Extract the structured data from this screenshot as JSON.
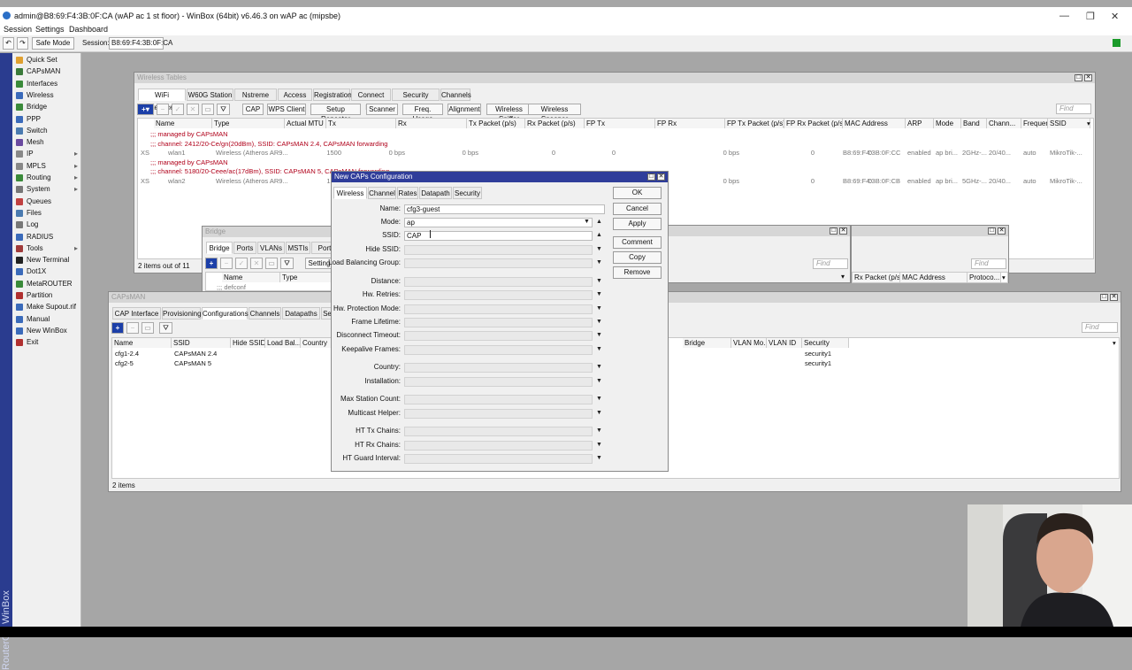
{
  "window": {
    "title": "admin@B8:69:F4:3B:0F:CA (wAP ac 1 st floor) - WinBox (64bit) v6.46.3 on wAP ac (mipsbe)",
    "minimize": "—",
    "maximize": "❐",
    "close": "✕"
  },
  "menu": [
    "Session",
    "Settings",
    "Dashboard"
  ],
  "toolbar": {
    "undo": "↶",
    "redo": "↷",
    "safe_mode": "Safe Mode",
    "session_label": "Session:",
    "session_value": "B8:69:F4:3B:0F:CA",
    "status_icon": "connected-square"
  },
  "brand": "RouterOS WinBox",
  "sidebar": [
    {
      "label": "Quick Set",
      "icon": "quick-set-icon",
      "color": "#e0a030"
    },
    {
      "label": "CAPsMAN",
      "icon": "capsman-icon",
      "color": "#3a7a3a"
    },
    {
      "label": "Interfaces",
      "icon": "interfaces-icon",
      "color": "#3a8a3a"
    },
    {
      "label": "Wireless",
      "icon": "wireless-icon",
      "color": "#3a6aba"
    },
    {
      "label": "Bridge",
      "icon": "bridge-icon",
      "color": "#3a8a3a"
    },
    {
      "label": "PPP",
      "icon": "ppp-icon",
      "color": "#3a6aba"
    },
    {
      "label": "Switch",
      "icon": "switch-icon",
      "color": "#4a7ab0"
    },
    {
      "label": "Mesh",
      "icon": "mesh-icon",
      "color": "#6a4aa0"
    },
    {
      "label": "IP",
      "icon": "ip-icon",
      "color": "#888",
      "arrow": "▸"
    },
    {
      "label": "MPLS",
      "icon": "mpls-icon",
      "color": "#888",
      "arrow": "▸"
    },
    {
      "label": "Routing",
      "icon": "routing-icon",
      "color": "#3a8a3a",
      "arrow": "▸"
    },
    {
      "label": "System",
      "icon": "system-icon",
      "color": "#777",
      "arrow": "▸"
    },
    {
      "label": "Queues",
      "icon": "queues-icon",
      "color": "#c04040"
    },
    {
      "label": "Files",
      "icon": "files-icon",
      "color": "#4a7ab0"
    },
    {
      "label": "Log",
      "icon": "log-icon",
      "color": "#777"
    },
    {
      "label": "RADIUS",
      "icon": "radius-icon",
      "color": "#3a6aba"
    },
    {
      "label": "Tools",
      "icon": "tools-icon",
      "color": "#a03a3a",
      "arrow": "▸"
    },
    {
      "label": "New Terminal",
      "icon": "terminal-icon",
      "color": "#222"
    },
    {
      "label": "Dot1X",
      "icon": "dot1x-icon",
      "color": "#3a6aba"
    },
    {
      "label": "MetaROUTER",
      "icon": "metarouter-icon",
      "color": "#3a8a3a"
    },
    {
      "label": "Partition",
      "icon": "partition-icon",
      "color": "#b03030"
    },
    {
      "label": "Make Supout.rif",
      "icon": "supout-icon",
      "color": "#3a6aba"
    },
    {
      "label": "Manual",
      "icon": "manual-icon",
      "color": "#3a6aba"
    },
    {
      "label": "New WinBox",
      "icon": "winbox-icon",
      "color": "#3a6aba"
    },
    {
      "label": "Exit",
      "icon": "exit-icon",
      "color": "#b03030"
    }
  ],
  "wt": {
    "title": "Wireless Tables",
    "tabs": [
      "WiFi Interfaces",
      "W60G Station",
      "Nstreme Dual",
      "Access List",
      "Registration",
      "Connect List",
      "Security Profiles",
      "Channels"
    ],
    "buttons": [
      "CAP",
      "WPS Client",
      "Setup Repeater",
      "Scanner",
      "Freq. Usage",
      "Alignment",
      "Wireless Sniffer",
      "Wireless Snooper"
    ],
    "find": "Find",
    "columns": [
      "Name",
      "Type",
      "Actual MTU",
      "Tx",
      "Rx",
      "Tx Packet (p/s)",
      "Rx Packet (p/s)",
      "FP Tx",
      "FP Rx",
      "FP Tx Packet (p/s)",
      "FP Rx Packet (p/s)",
      "MAC Address",
      "ARP",
      "Mode",
      "Band",
      "Chann...",
      "Frequen...",
      "SSID"
    ],
    "rows": [
      {
        "comment": ";;; managed by CAPsMAN"
      },
      {
        "comment": ";;; channel: 2412/20-Ce/gn(20dBm), SSID: CAPsMAN 2.4, CAPsMAN forwarding"
      },
      {
        "flags": "XS",
        "name": "wlan1",
        "type": "Wireless (Atheros AR9...",
        "mtu": "1500",
        "tx": "0 bps",
        "rx": "0 bps",
        "txp": "0",
        "rxp": "0",
        "fptx": "",
        "fprx": "0 bps",
        "fptxp": "0",
        "fprxp": "0",
        "mac": "B8:69:F4:3B:0F:CC",
        "arp": "enabled",
        "mode": "ap bri...",
        "band": "2GHz-...",
        "chan": "20/40...",
        "freq": "auto",
        "ssid": "MikroTik-..."
      },
      {
        "comment": ";;; managed by CAPsMAN"
      },
      {
        "comment": ";;; channel: 5180/20-Ceee/ac(17dBm), SSID: CAPsMAN 5, CAPsMAN forwarding"
      },
      {
        "flags": "XS",
        "name": "wlan2",
        "type": "Wireless (Atheros AR9...",
        "mtu": "1500",
        "tx": "",
        "rx": "",
        "txp": "",
        "rxp": "",
        "fptx": "",
        "fprx": "0 bps",
        "fptxp": "0",
        "fprxp": "0",
        "mac": "B8:69:F4:3B:0F:CB",
        "arp": "enabled",
        "mode": "ap bri...",
        "band": "5GHz-...",
        "chan": "20/40...",
        "freq": "auto",
        "ssid": "MikroTik-..."
      }
    ],
    "status": "2 items out of 11"
  },
  "bridge": {
    "title": "Bridge",
    "tabs": [
      "Bridge",
      "Ports",
      "VLANs",
      "MSTIs",
      "Port MS"
    ],
    "settings": "Settings",
    "columns": [
      "Name",
      "Type"
    ],
    "row": ";;; defconf",
    "find": "Find"
  },
  "midwin": {
    "find": "Find"
  },
  "rightwin": {
    "find": "Find",
    "columns": [
      "Rx Packet (p/s)",
      "MAC Address",
      "Protoco..."
    ]
  },
  "capsman": {
    "title": "CAPsMAN",
    "tabs": [
      "CAP Interface",
      "Provisioning",
      "Configurations",
      "Channels",
      "Datapaths",
      "Se"
    ],
    "find": "Find",
    "columns": [
      "Name",
      "SSID",
      "Hide SSID",
      "Load Bal...",
      "Country"
    ],
    "columns_right": [
      "Bridge",
      "VLAN Mo...",
      "VLAN ID",
      "Security"
    ],
    "rows": [
      {
        "name": "cfg1-2.4",
        "ssid": "CAPsMAN 2.4",
        "security": "security1"
      },
      {
        "name": "cfg2-5",
        "ssid": "CAPsMAN 5",
        "security": "security1"
      }
    ],
    "status": "2 items"
  },
  "dialog": {
    "title": "New CAPs Configuration",
    "tabs": [
      "Wireless",
      "Channel",
      "Rates",
      "Datapath",
      "Security"
    ],
    "fields": [
      {
        "label": "Name:",
        "value": "cfg3-guest"
      },
      {
        "label": "Mode:",
        "value": "ap"
      },
      {
        "label": "SSID:",
        "value": "CAP"
      },
      {
        "label": "Hide SSID:",
        "value": ""
      },
      {
        "label": "Load Balancing Group:",
        "value": ""
      },
      {
        "label": "Distance:",
        "value": ""
      },
      {
        "label": "Hw. Retries:",
        "value": ""
      },
      {
        "label": "Hw. Protection Mode:",
        "value": ""
      },
      {
        "label": "Frame Lifetime:",
        "value": ""
      },
      {
        "label": "Disconnect Timeout:",
        "value": ""
      },
      {
        "label": "Keepalive Frames:",
        "value": ""
      },
      {
        "label": "Country:",
        "value": ""
      },
      {
        "label": "Installation:",
        "value": ""
      },
      {
        "label": "Max Station Count:",
        "value": ""
      },
      {
        "label": "Multicast Helper:",
        "value": ""
      },
      {
        "label": "HT Tx Chains:",
        "value": ""
      },
      {
        "label": "HT Rx Chains:",
        "value": ""
      },
      {
        "label": "HT Guard Interval:",
        "value": ""
      }
    ],
    "buttons": [
      "OK",
      "Cancel",
      "Apply",
      "Comment",
      "Copy",
      "Remove"
    ]
  }
}
